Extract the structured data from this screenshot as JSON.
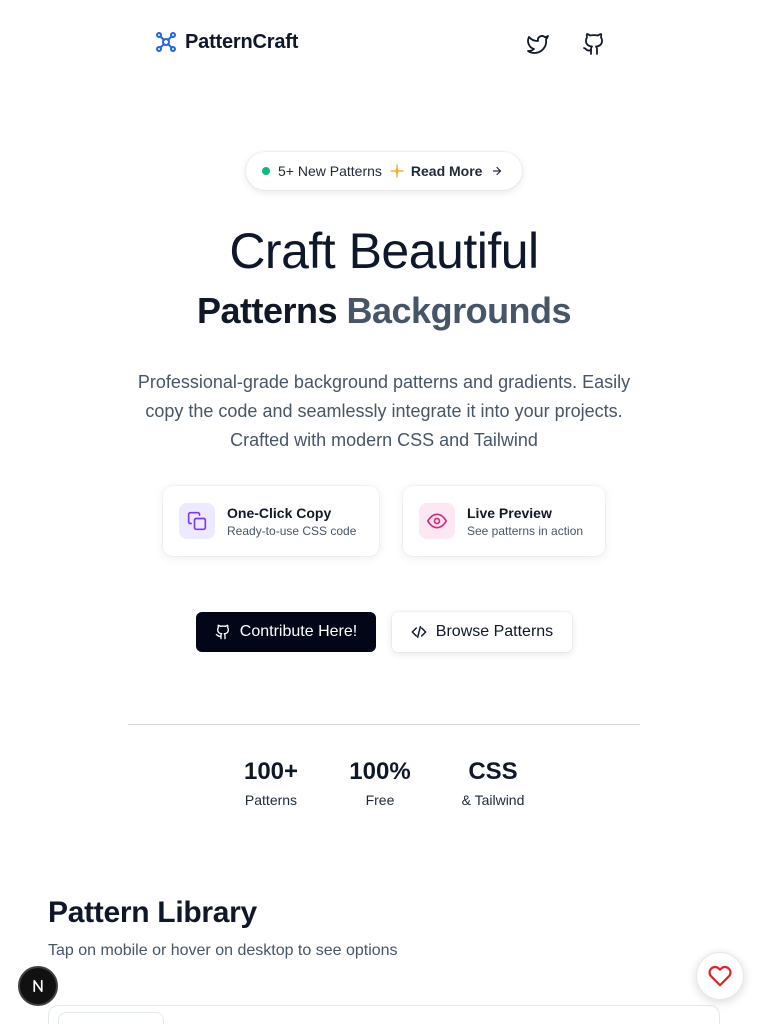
{
  "brand": {
    "name": "PatternCraft",
    "icon": "git-network-icon",
    "accent": "#2563eb"
  },
  "nav": {
    "twitter_icon": "twitter-icon",
    "github_icon": "github-icon"
  },
  "announcement": {
    "text": "5+ New Patterns",
    "link_label": "Read More",
    "dot_color": "#10b981",
    "spark_color": "#f59e0b"
  },
  "hero": {
    "title_line1": "Craft Beautiful",
    "title_word1": "Patterns",
    "title_word2": "Backgrounds",
    "description": "Professional-grade background patterns and gradients. Easily copy the code and seamlessly integrate it into your projects. Crafted with modern CSS and Tailwind"
  },
  "features": [
    {
      "title": "One-Click Copy",
      "subtitle": "Ready-to-use CSS code",
      "icon": "copy-icon",
      "color": "#7c3aed"
    },
    {
      "title": "Live Preview",
      "subtitle": "See patterns in action",
      "icon": "eye-icon",
      "color": "#db2777"
    }
  ],
  "actions": {
    "contribute_label": "Contribute Here!",
    "browse_label": "Browse Patterns"
  },
  "stats": [
    {
      "value": "100+",
      "label": "Patterns"
    },
    {
      "value": "100%",
      "label": "Free"
    },
    {
      "value": "CSS",
      "label": "& Tailwind"
    }
  ],
  "library": {
    "title": "Pattern Library",
    "subtitle": "Tap on mobile or hover on desktop to see options"
  },
  "floating": {
    "framework_badge": "N",
    "favorite_icon": "heart-icon",
    "favorite_color": "#dc2626"
  }
}
